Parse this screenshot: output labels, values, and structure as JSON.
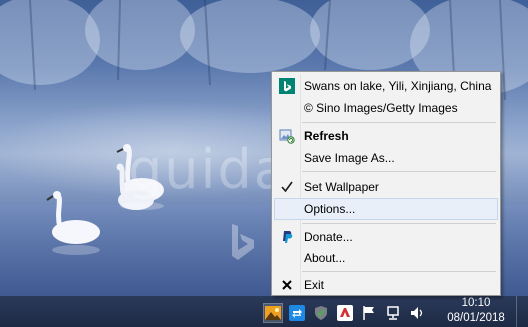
{
  "watermark": {
    "text": "guidami.info"
  },
  "menu": {
    "title_line": "Swans on lake, Yili, Xinjiang, China",
    "copyright_line": "© Sino Images/Getty Images",
    "refresh": "Refresh",
    "save_image": "Save Image As...",
    "set_wallpaper": "Set Wallpaper",
    "set_wallpaper_checked": true,
    "options": "Options...",
    "donate": "Donate...",
    "about": "About...",
    "exit": "Exit"
  },
  "taskbar": {
    "time": "10:10",
    "date": "08/01/2018",
    "tray_icons": [
      "bing-wallpaper-icon",
      "sync-icon",
      "security-shield-icon",
      "antivirus-icon",
      "flag-icon",
      "network-icon",
      "volume-icon"
    ]
  },
  "colors": {
    "bing_green": "#008373",
    "menu_bg": "#f2f2f2",
    "highlight": "#e8eff9",
    "taskbar": "#1e2a44"
  }
}
